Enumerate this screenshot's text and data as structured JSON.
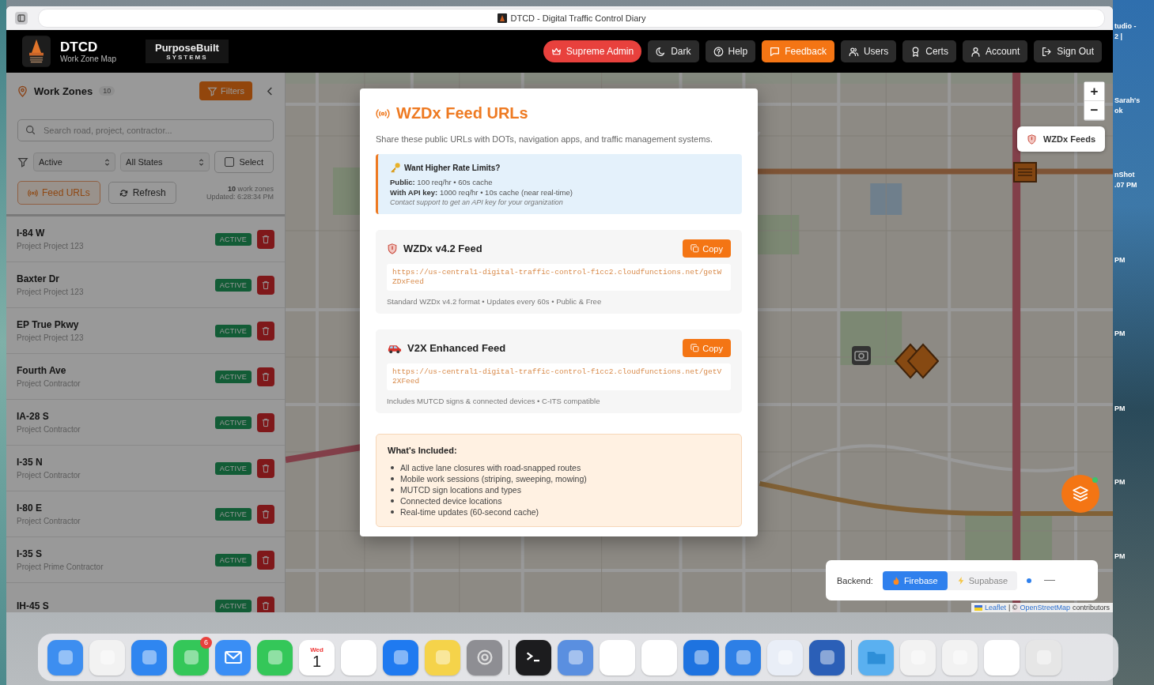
{
  "browser": {
    "title": "DTCD - Digital Traffic Control Diary"
  },
  "header": {
    "app_name": "DTCD",
    "app_subtitle": "Work Zone Map",
    "partner_name": "PurposeBuilt",
    "partner_tagline": "SYSTEMS",
    "buttons": [
      {
        "label": "Supreme Admin",
        "kind": "role"
      },
      {
        "label": "Dark",
        "kind": "plain"
      },
      {
        "label": "Help",
        "kind": "plain"
      },
      {
        "label": "Feedback",
        "kind": "accent"
      },
      {
        "label": "Users",
        "kind": "plain"
      },
      {
        "label": "Certs",
        "kind": "plain"
      },
      {
        "label": "Account",
        "kind": "plain"
      },
      {
        "label": "Sign Out",
        "kind": "plain"
      }
    ]
  },
  "sidebar": {
    "title": "Work Zones",
    "count": "10",
    "filters_button": "Filters",
    "search": {
      "placeholder": "Search road, project, contractor..."
    },
    "status_select": "Active",
    "state_select": "All States",
    "select_button": "Select",
    "feed_urls_button": "Feed URLs",
    "refresh_button": "Refresh",
    "zone_count": "10",
    "zone_count_label": "work zones",
    "updated": "Updated: 6:28:34 PM",
    "zones": [
      {
        "road": "I-84 W",
        "project": "Project Project 123",
        "status": "ACTIVE"
      },
      {
        "road": "Baxter Dr",
        "project": "Project Project 123",
        "status": "ACTIVE"
      },
      {
        "road": "EP True Pkwy",
        "project": "Project Project 123",
        "status": "ACTIVE"
      },
      {
        "road": "Fourth Ave",
        "project": "Project Contractor",
        "status": "ACTIVE"
      },
      {
        "road": "IA-28 S",
        "project": "Project Contractor",
        "status": "ACTIVE"
      },
      {
        "road": "I-35 N",
        "project": "Project Contractor",
        "status": "ACTIVE"
      },
      {
        "road": "I-80 E",
        "project": "Project Contractor",
        "status": "ACTIVE"
      },
      {
        "road": "I-35 S",
        "project": "Project Prime Contractor",
        "status": "ACTIVE"
      },
      {
        "road": "IH-45 S",
        "status": "ACTIVE"
      }
    ]
  },
  "map": {
    "feeds_button": "WZDx Feeds",
    "zoom_in": "+",
    "zoom_out": "−",
    "backend": {
      "label": "Backend:",
      "options": [
        {
          "label": "Firebase",
          "kind": "fire",
          "selected": true
        },
        {
          "label": "Supabase",
          "kind": "bolt",
          "selected": false
        }
      ]
    },
    "attribution_leaflet": "Leaflet",
    "attribution_rest": "| ©",
    "attribution_osm": "OpenStreetMap",
    "attribution_tail": "contributors"
  },
  "modal": {
    "title": "WZDx Feed URLs",
    "description": "Share these public URLs with DOTs, navigation apps, and traffic management systems.",
    "notice": {
      "title": "Want Higher Rate Limits?",
      "lines": [
        "**Public:** 100 req/hr • 60s cache",
        "**With API key:** 1000 req/hr • 10s cache (near real-time)"
      ],
      "note": "Contact support to get an API key for your organization"
    },
    "feeds": [
      {
        "kind": "wzdx",
        "title": "WZDx v4.2 Feed",
        "copy": "Copy",
        "url": "https://us-central1-digital-traffic-control-f1cc2.cloudfunctions.net/getWZDxFeed",
        "details": "Standard WZDx v4.2 format • Updates every 60s • Public & Free"
      },
      {
        "kind": "v2x",
        "title": "V2X Enhanced Feed",
        "copy": "Copy",
        "url": "https://us-central1-digital-traffic-control-f1cc2.cloudfunctions.net/getV2XFeed",
        "details": "Includes MUTCD signs & connected devices • C-ITS compatible"
      }
    ],
    "included": {
      "title": "What's Included:",
      "items": [
        "All active lane closures with road-snapped routes",
        "Mobile work sessions (striping, sweeping, mowing)",
        "MUTCD sign locations and types",
        "Connected device locations",
        "Real-time updates (60-second cache)"
      ]
    }
  },
  "desktop_labels": [
    "tudio -",
    "2 |",
    "Sarah's",
    "ok",
    "nShot",
    ".07 PM",
    "PM",
    "PM",
    "PM",
    "PM",
    "PM"
  ],
  "dock": {
    "badge": "6",
    "calendar_day": "Wed",
    "calendar_date": "1"
  }
}
